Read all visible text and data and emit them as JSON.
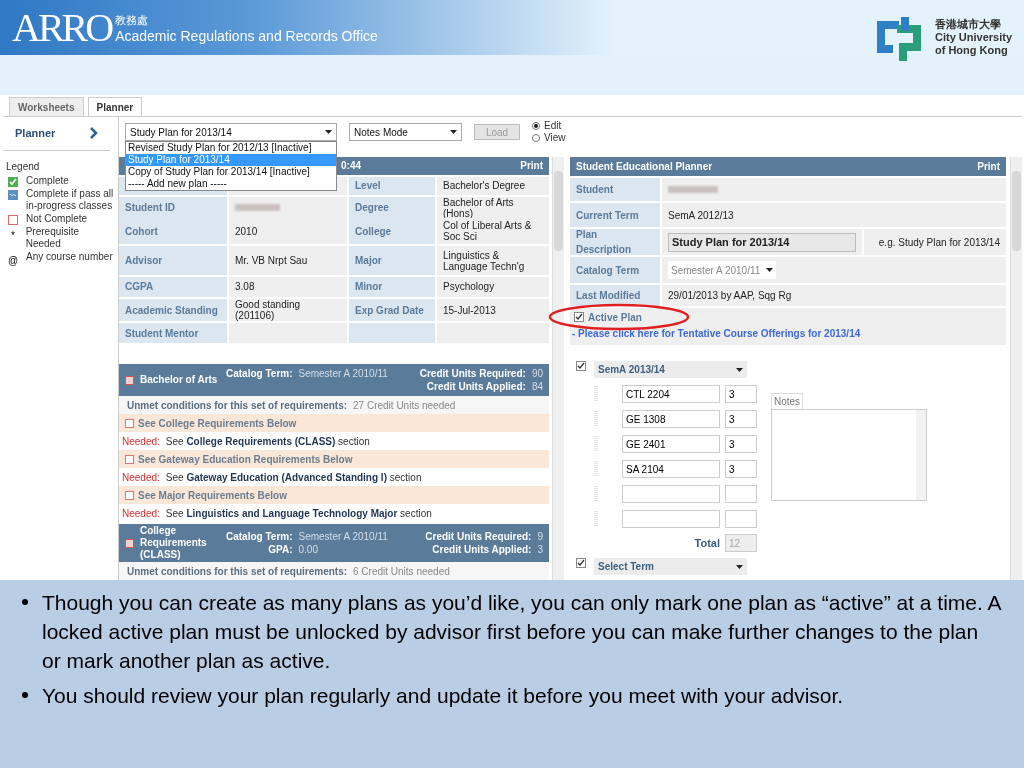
{
  "banner": {
    "logo_text": "ARRO",
    "chinese_name": "教務處",
    "office_name": "Academic Regulations and Records Office",
    "university_chinese": "香港城市大學",
    "university_lines": [
      "City University",
      "of Hong Kong"
    ]
  },
  "tabs": [
    {
      "label": "Worksheets",
      "selected": false
    },
    {
      "label": "Planner",
      "selected": true
    }
  ],
  "sidebar": {
    "title": "Planner",
    "legend_title": "Legend",
    "legend": [
      {
        "kind": "complete",
        "label": "Complete"
      },
      {
        "kind": "in_progress",
        "label": "Complete if pass all in-progress classes"
      },
      {
        "kind": "not_complete",
        "label": "Not Complete"
      },
      {
        "kind": "symbol",
        "symbol": "*",
        "label": "Prerequisite Needed"
      },
      {
        "kind": "symbol",
        "symbol": "@",
        "label": "Any course number"
      }
    ]
  },
  "toolbar": {
    "plan_select": "Study Plan for 2013/14",
    "mode_select": "Notes Mode",
    "load_button": "Load",
    "modes": [
      {
        "label": "Edit",
        "selected": true
      },
      {
        "label": "View",
        "selected": false
      }
    ]
  },
  "plan_dropdown": [
    {
      "label": "Revised Study Plan for 2012/13 [Inactive]",
      "selected": false
    },
    {
      "label": "Study Plan for 2013/14",
      "selected": true
    },
    {
      "label": "Copy of Study Plan for 2013/14 [Inactive]",
      "selected": false
    },
    {
      "label": "----- Add new plan -----",
      "selected": false
    }
  ],
  "worksheet": {
    "header": "0:44",
    "print": "Print",
    "info_rows": [
      {
        "right_label": "Level",
        "right_value": "Bachelor's Degree"
      },
      {
        "left_label": "Student ID",
        "left_blurred": true,
        "right_label": "Degree",
        "right_value": "Bachelor of Arts (Hons)"
      },
      {
        "left_label": "Cohort",
        "left_value": "2010",
        "right_label": "College",
        "right_value": "Col of Liberal Arts & Soc Sci"
      },
      {
        "left_label": "Advisor",
        "left_value": "Mr. VB Nrpt Sau",
        "right_label": "Major",
        "right_value": "Linguistics & Language Techn'g"
      },
      {
        "left_label": "CGPA",
        "left_value": "3.08",
        "right_label": "Minor",
        "right_value": "Psychology"
      },
      {
        "left_label": "Academic Standing",
        "left_value": "Good standing (201106)",
        "right_label": "Exp Grad Date",
        "right_value": "15-Jul-2013"
      },
      {
        "left_label": "Student Mentor"
      }
    ],
    "blocks": [
      {
        "title": "Bachelor of Arts",
        "checked": false,
        "catalog_label": "Catalog Term:",
        "catalog_term": "Semester A 2010/11",
        "required_label": "Credit Units Required:",
        "required": "90",
        "applied_label": "Credit Units Applied:",
        "applied": "84",
        "lines": [
          {
            "kind": "unmet",
            "label": "Unmet conditions for this set of requirements:",
            "text": "27 Credit Units needed"
          },
          {
            "kind": "requirement",
            "checked": false,
            "text": "See College Requirements Below"
          },
          {
            "kind": "needed",
            "label": "Needed:",
            "text": "See **College Requirements (CLASS)** section"
          },
          {
            "kind": "requirement",
            "checked": false,
            "text": "See Gateway Education Requirements Below"
          },
          {
            "kind": "needed",
            "label": "Needed:",
            "text": "See **Gateway Education (Advanced Standing I)** section"
          },
          {
            "kind": "requirement",
            "checked": false,
            "text": "See Major Requirements Below"
          },
          {
            "kind": "needed",
            "label": "Needed:",
            "text": "See **Linguistics and Language Technology Major** section"
          }
        ]
      },
      {
        "title": "College Requirements (CLASS)",
        "checked": false,
        "catalog_label": "Catalog Term:",
        "catalog_term": "Semester A 2010/11",
        "gpa_label": "GPA:",
        "gpa": "0.00",
        "required_label": "Credit Units Required:",
        "required": "9",
        "applied_label": "Credit Units Applied:",
        "applied": "3",
        "lines": [
          {
            "kind": "unmet",
            "label": "Unmet conditions for this set of requirements:",
            "text": "6 Credit Units needed"
          }
        ]
      }
    ]
  },
  "planner": {
    "title": "Student Educational Planner",
    "print": "Print",
    "rows": [
      {
        "kind": "blurred",
        "label": "Student"
      },
      {
        "kind": "text",
        "label": "Current Term",
        "value": "SemA 2012/13"
      },
      {
        "kind": "input",
        "label": "Plan Description",
        "value": "Study Plan for 2013/14",
        "hint": "e.g. Study Plan for 2013/14"
      },
      {
        "kind": "select",
        "label": "Catalog Term",
        "value": "Semester A 2010/11",
        "disabled": true
      },
      {
        "kind": "text",
        "label": "Last Modified",
        "value": "29/01/2013 by AAP, Sqg Rg"
      }
    ],
    "active_plan": {
      "label": "Active Plan",
      "checked": true,
      "annotation": {
        "kind": "ellipse"
      }
    },
    "link": "- Please click here for Tentative Course Offerings for 2013/14",
    "terms": [
      {
        "checked": true,
        "term": "SemA 2013/14",
        "courses": [
          {
            "kind": "course",
            "code": "CTL 2204",
            "units": "3"
          },
          {
            "kind": "course",
            "code": "GE 1308",
            "units": "3"
          },
          {
            "kind": "course",
            "code": "GE 2401",
            "units": "3"
          },
          {
            "kind": "course",
            "code": "SA 2104",
            "units": "3"
          },
          {
            "kind": "blank"
          },
          {
            "kind": "blank"
          }
        ],
        "total_label": "Total",
        "total": "12"
      },
      {
        "checked": true,
        "term": "Select Term"
      }
    ],
    "notes_label": "Notes"
  },
  "bullets": [
    "Though you can create as many plans as you’d like, you can only mark one plan as “active” at a time. A locked active plan must be unlocked by advisor first before you can make further changes to the plan or mark another plan as active.",
    "You should review your plan regularly and update it before you meet with your advisor."
  ]
}
